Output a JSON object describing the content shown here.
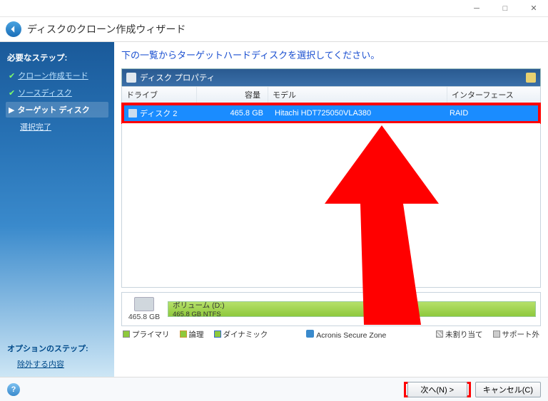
{
  "window": {
    "title": "ディスクのクローン作成ウィザード"
  },
  "sidebar": {
    "required_title": "必要なステップ:",
    "steps": [
      {
        "label": "クローン作成モード"
      },
      {
        "label": "ソースディスク"
      },
      {
        "label": "ターゲット ディスク"
      },
      {
        "label": "選択完了"
      }
    ],
    "options_title": "オプションのステップ:",
    "options_link": "除外する内容"
  },
  "content": {
    "instruction": "下の一覧からターゲットハードディスクを選択してください。",
    "panel_title": "ディスク プロパティ",
    "columns": {
      "drive": "ドライブ",
      "capacity": "容量",
      "model": "モデル",
      "interface": "インターフェース"
    },
    "row": {
      "drive": "ディスク 2",
      "capacity": "465.8 GB",
      "model": "Hitachi HDT725050VLA380",
      "interface": "RAID"
    },
    "vol_capacity": "465.8 GB",
    "vol_name": "ボリューム (D:)",
    "vol_detail": "465.8 GB  NTFS",
    "legend": {
      "primary": "プライマリ",
      "logical": "論理",
      "dynamic": "ダイナミック",
      "asz": "Acronis Secure Zone",
      "unalloc": "未割り当て",
      "unsupported": "サポート外"
    }
  },
  "footer": {
    "next": "次へ(N) >",
    "cancel": "キャンセル(C)"
  }
}
